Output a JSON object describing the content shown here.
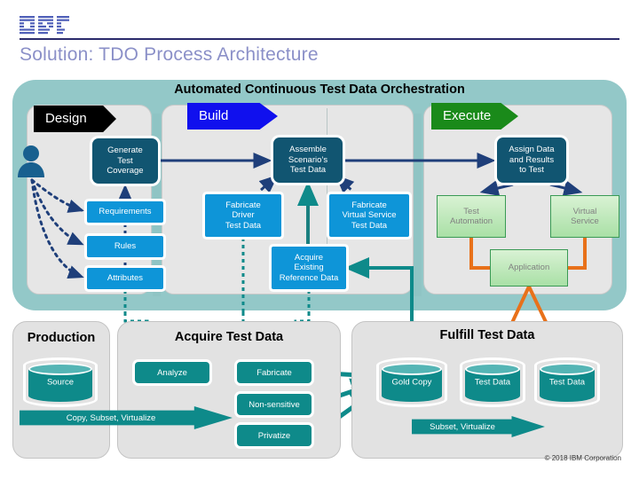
{
  "header": {
    "logo": "ibm-logo",
    "title": "Solution: TDO Process Architecture"
  },
  "orchestration": {
    "title": "Automated Continuous Test Data Orchestration",
    "phases": [
      {
        "label": "Design",
        "color": "#000000"
      },
      {
        "label": "Build",
        "color": "#1010ee"
      },
      {
        "label": "Execute",
        "color": "#1a8a1a"
      }
    ],
    "design": {
      "generate_coverage": "Generate\nTest\nCoverage",
      "generate_coverage_lines": [
        "Generate",
        "Test",
        "Coverage"
      ],
      "requirements": "Requirements",
      "rules": "Rules",
      "attributes": "Attributes",
      "actor": "person-icon"
    },
    "build": {
      "assemble_lines": [
        "Assemble",
        "Scenario’s",
        "Test Data"
      ],
      "fabricate_driver_lines": [
        "Fabricate",
        "Driver",
        "Test Data"
      ],
      "fabricate_vs_lines": [
        "Fabricate",
        "Virtual Service",
        "Test Data"
      ],
      "acquire_ref_lines": [
        "Acquire",
        "Existing",
        "Reference Data"
      ]
    },
    "execute": {
      "assign_lines": [
        "Assign Data",
        "and Results",
        "to Test"
      ],
      "test_automation_lines": [
        "Test",
        "Automation"
      ],
      "virtual_service_lines": [
        "Virtual",
        "Service"
      ],
      "application": "Application"
    }
  },
  "bottom": {
    "production": {
      "title": "Production",
      "source": "Source",
      "copy_arrow": "Copy, Subset, Virtualize"
    },
    "acquire": {
      "title": "Acquire Test Data",
      "analyze": "Analyze",
      "fabricate": "Fabricate",
      "non_sensitive": "Non-sensitive",
      "privatize": "Privatize"
    },
    "fulfill": {
      "title": "Fulfill Test Data",
      "gold_copy": "Gold Copy",
      "test_data_1": "Test Data",
      "test_data_2": "Test Data",
      "subset_arrow": "Subset, Virtualize"
    }
  },
  "footer": {
    "copyright": "© 2018 IBM Corporation"
  },
  "colors": {
    "teal_container": "#93c8c8",
    "panel_gray": "#e6e6e6",
    "node_dark": "#115571",
    "node_blue": "#0e95d8",
    "node_green": "#b9e6b3",
    "teal": "#0e8a8a",
    "orange": "#e8711a",
    "navy_arrow": "#1f3f7a",
    "title_blue": "#8b90c8"
  }
}
